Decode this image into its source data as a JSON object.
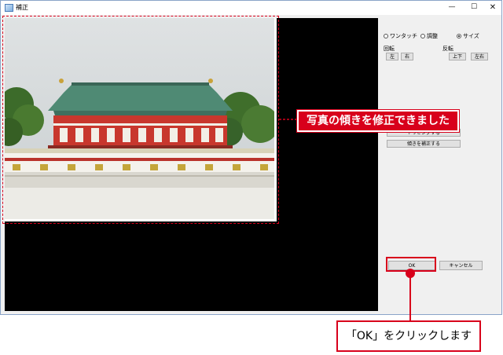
{
  "window": {
    "title": "補正",
    "controls": {
      "minimize": "—",
      "maximize": "☐",
      "close": "✕"
    }
  },
  "panel": {
    "modes": [
      {
        "label": "ワンタッチ",
        "selected": false
      },
      {
        "label": "調整",
        "selected": false
      },
      {
        "label": "サイズ",
        "selected": true
      }
    ],
    "rotate": {
      "label": "回転",
      "left": "左",
      "right": "右"
    },
    "flip": {
      "label": "反転",
      "vertical": "上下",
      "horizontal": "左右"
    },
    "trim_button": "トリミングする",
    "tilt_button": "傾きを補正する",
    "ok_button": "OK",
    "cancel_button": "キャンセル"
  },
  "annotations": {
    "callout_text": "写真の傾きを修正できました",
    "instruction_text": "「OK」をクリックします"
  },
  "colors": {
    "annotation_red": "#d8001b",
    "preview_bg": "#000000"
  }
}
